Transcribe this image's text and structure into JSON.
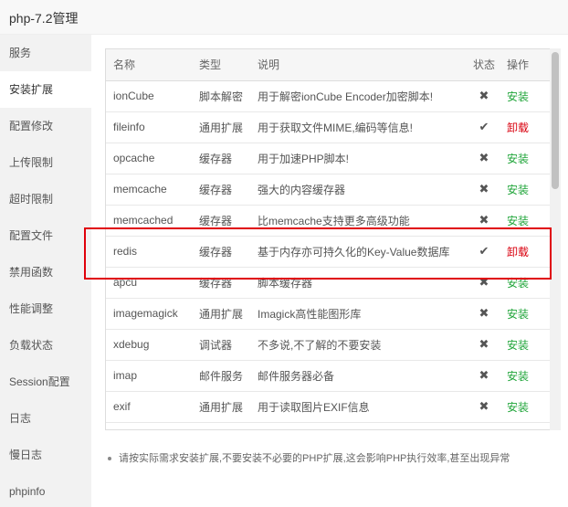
{
  "window": {
    "title": "php-7.2管理"
  },
  "sidebar": {
    "items": [
      {
        "label": "服务",
        "active": false
      },
      {
        "label": "安装扩展",
        "active": true
      },
      {
        "label": "配置修改",
        "active": false
      },
      {
        "label": "上传限制",
        "active": false
      },
      {
        "label": "超时限制",
        "active": false
      },
      {
        "label": "配置文件",
        "active": false
      },
      {
        "label": "禁用函数",
        "active": false
      },
      {
        "label": "性能调整",
        "active": false
      },
      {
        "label": "负载状态",
        "active": false
      },
      {
        "label": "Session配置",
        "active": false
      },
      {
        "label": "日志",
        "active": false
      },
      {
        "label": "慢日志",
        "active": false
      },
      {
        "label": "phpinfo",
        "active": false
      }
    ]
  },
  "table": {
    "headers": {
      "name": "名称",
      "type": "类型",
      "desc": "说明",
      "status": "状态",
      "op": "操作"
    },
    "rows": [
      {
        "name": "ionCube",
        "type": "脚本解密",
        "desc": "用于解密ionCube Encoder加密脚本!",
        "status": "✖",
        "installed": false,
        "op": "安装"
      },
      {
        "name": "fileinfo",
        "type": "通用扩展",
        "desc": "用于获取文件MIME,编码等信息!",
        "status": "✔",
        "installed": true,
        "op": "卸载"
      },
      {
        "name": "opcache",
        "type": "缓存器",
        "desc": "用于加速PHP脚本!",
        "status": "✖",
        "installed": false,
        "op": "安装"
      },
      {
        "name": "memcache",
        "type": "缓存器",
        "desc": "强大的内容缓存器",
        "status": "✖",
        "installed": false,
        "op": "安装"
      },
      {
        "name": "memcached",
        "type": "缓存器",
        "desc": "比memcache支持更多高级功能",
        "status": "✖",
        "installed": false,
        "op": "安装"
      },
      {
        "name": "redis",
        "type": "缓存器",
        "desc": "基于内存亦可持久化的Key-Value数据库",
        "status": "✔",
        "installed": true,
        "op": "卸载"
      },
      {
        "name": "apcu",
        "type": "缓存器",
        "desc": "脚本缓存器",
        "status": "✖",
        "installed": false,
        "op": "安装"
      },
      {
        "name": "imagemagick",
        "type": "通用扩展",
        "desc": "Imagick高性能图形库",
        "status": "✖",
        "installed": false,
        "op": "安装"
      },
      {
        "name": "xdebug",
        "type": "调试器",
        "desc": "不多说,不了解的不要安装",
        "status": "✖",
        "installed": false,
        "op": "安装"
      },
      {
        "name": "imap",
        "type": "邮件服务",
        "desc": "邮件服务器必备",
        "status": "✖",
        "installed": false,
        "op": "安装"
      },
      {
        "name": "exif",
        "type": "通用扩展",
        "desc": "用于读取图片EXIF信息",
        "status": "✖",
        "installed": false,
        "op": "安装"
      }
    ]
  },
  "note": {
    "text": "请按实际需求安装扩展,不要安装不必要的PHP扩展,这会影响PHP执行效率,甚至出现异常"
  },
  "colors": {
    "install": "#20a53a",
    "uninstall": "#d9000e",
    "highlight": "#e0000a"
  }
}
